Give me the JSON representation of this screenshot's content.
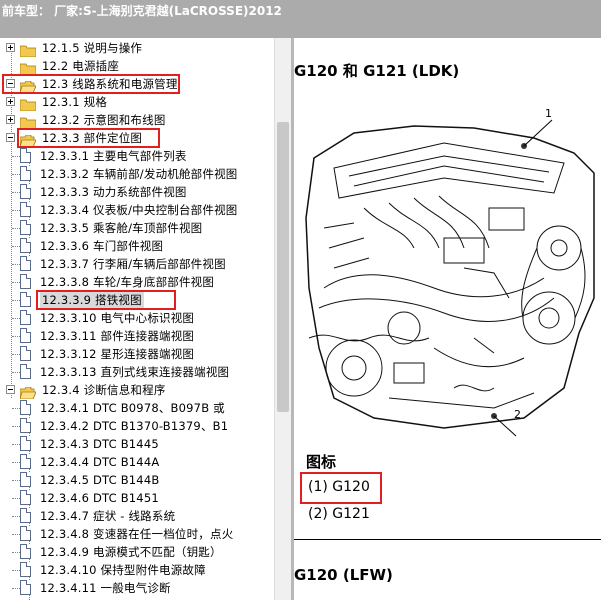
{
  "window": {
    "title": "前车型： 厂家:S-上海别克君越(LaCROSSE)2012"
  },
  "tree": {
    "items": [
      {
        "label": "12.1.5 说明与操作",
        "type": "folder",
        "expander": "plus"
      },
      {
        "label": "12.2 电源插座",
        "type": "folder",
        "expander": "none"
      },
      {
        "label": "12.3 线路系统和电源管理",
        "type": "folder-open",
        "expander": "minus",
        "highlight": true
      },
      {
        "label": "12.3.1 规格",
        "type": "folder",
        "expander": "plus"
      },
      {
        "label": "12.3.2 示意图和布线图",
        "type": "folder",
        "expander": "plus"
      },
      {
        "label": "12.3.3 部件定位图",
        "type": "folder-open",
        "expander": "minus",
        "highlight": true
      },
      {
        "label": "12.3.3.1 主要电气部件列表",
        "type": "doc"
      },
      {
        "label": "12.3.3.2 车辆前部/发动机舱部件视图",
        "type": "doc"
      },
      {
        "label": "12.3.3.3 动力系统部件视图",
        "type": "doc"
      },
      {
        "label": "12.3.3.4 仪表板/中央控制台部件视图",
        "type": "doc"
      },
      {
        "label": "12.3.3.5 乘客舱/车顶部件视图",
        "type": "doc"
      },
      {
        "label": "12.3.3.6 车门部件视图",
        "type": "doc"
      },
      {
        "label": "12.3.3.7 行李厢/车辆后部部件视图",
        "type": "doc"
      },
      {
        "label": "12.3.3.8 车轮/车身底部部件视图",
        "type": "doc"
      },
      {
        "label": "12.3.3.9 搭铁视图",
        "type": "doc",
        "highlight": true,
        "selected": true
      },
      {
        "label": "12.3.3.10 电气中心标识视图",
        "type": "doc"
      },
      {
        "label": "12.3.3.11 部件连接器端视图",
        "type": "doc"
      },
      {
        "label": "12.3.3.12 星形连接器端视图",
        "type": "doc"
      },
      {
        "label": "12.3.3.13 直列式线束连接器端视图",
        "type": "doc"
      },
      {
        "label": "12.3.4 诊断信息和程序",
        "type": "folder-open",
        "expander": "minus"
      },
      {
        "label": "12.3.4.1 DTC B0978、B097B 或",
        "type": "doc"
      },
      {
        "label": "12.3.4.2 DTC B1370-B1379、B1",
        "type": "doc"
      },
      {
        "label": "12.3.4.3 DTC B1445",
        "type": "doc"
      },
      {
        "label": "12.3.4.4 DTC B144A",
        "type": "doc"
      },
      {
        "label": "12.3.4.5 DTC B144B",
        "type": "doc"
      },
      {
        "label": "12.3.4.6 DTC B1451",
        "type": "doc"
      },
      {
        "label": "12.3.4.7 症状 - 线路系统",
        "type": "doc"
      },
      {
        "label": "12.3.4.8 变速器在任一档位时，点火",
        "type": "doc"
      },
      {
        "label": "12.3.4.9 电源模式不匹配（钥匙）",
        "type": "doc"
      },
      {
        "label": "12.3.4.10 保持型附件电源故障",
        "type": "doc"
      },
      {
        "label": "12.3.4.11 一般电气诊断",
        "type": "doc"
      }
    ]
  },
  "content": {
    "heading": "G120 和 G121 (LDK)",
    "callouts": [
      "1",
      "2"
    ],
    "legend_title": "图标",
    "legend_items": [
      "(1) G120",
      "(2) G121"
    ],
    "heading2": "G120 (LFW)"
  },
  "colors": {
    "title_bar": "#ababab",
    "highlight_box": "#e02020",
    "folder": "#f2c94c",
    "selected_bg": "#d9d9d9"
  }
}
